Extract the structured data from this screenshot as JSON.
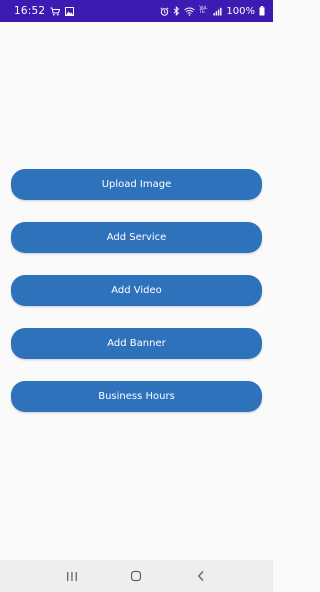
{
  "status_bar": {
    "time": "16:52",
    "battery": "100%",
    "left_icons": [
      "cart-icon",
      "image-icon"
    ],
    "right_icons": [
      "alarm-icon",
      "bluetooth-icon",
      "wifi-icon",
      "signal-icon"
    ],
    "network_label": "VoLTE",
    "background": "#3c1bb3"
  },
  "buttons": [
    {
      "label": "Upload Image"
    },
    {
      "label": "Add Service"
    },
    {
      "label": "Add Video"
    },
    {
      "label": "Add Banner"
    },
    {
      "label": "Business Hours"
    }
  ],
  "colors": {
    "button": "#2f72bc",
    "background": "#fafafa",
    "nav_bar": "#eeeeee"
  },
  "nav_bar": {
    "icons": [
      "recent-apps-icon",
      "home-icon",
      "back-icon"
    ]
  }
}
